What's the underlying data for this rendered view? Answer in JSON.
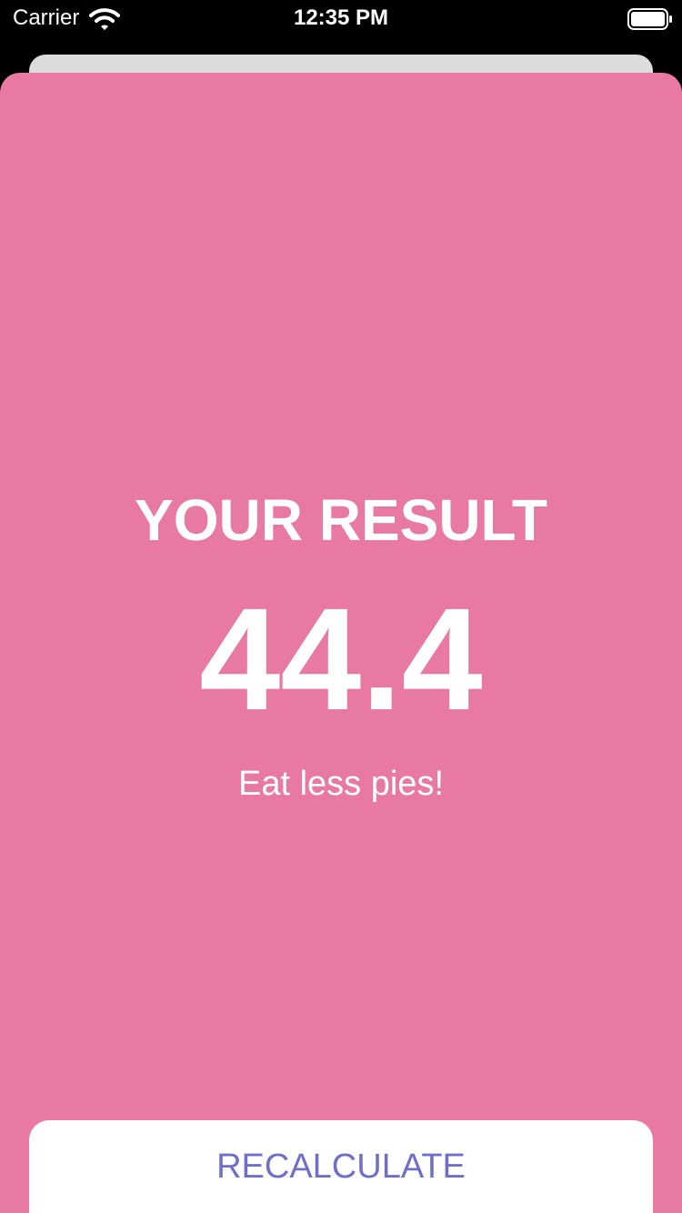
{
  "status_bar": {
    "carrier": "Carrier",
    "time": "12:35 PM",
    "wifi_icon": "wifi-icon",
    "battery_icon": "battery-icon"
  },
  "result": {
    "title": "YOUR RESULT",
    "value": "44.4",
    "advice": "Eat less pies!"
  },
  "actions": {
    "recalculate_label": "RECALCULATE"
  },
  "colors": {
    "background": "#e879a2",
    "button_text": "#6f6fc9",
    "status_bar_bg": "#000000"
  }
}
